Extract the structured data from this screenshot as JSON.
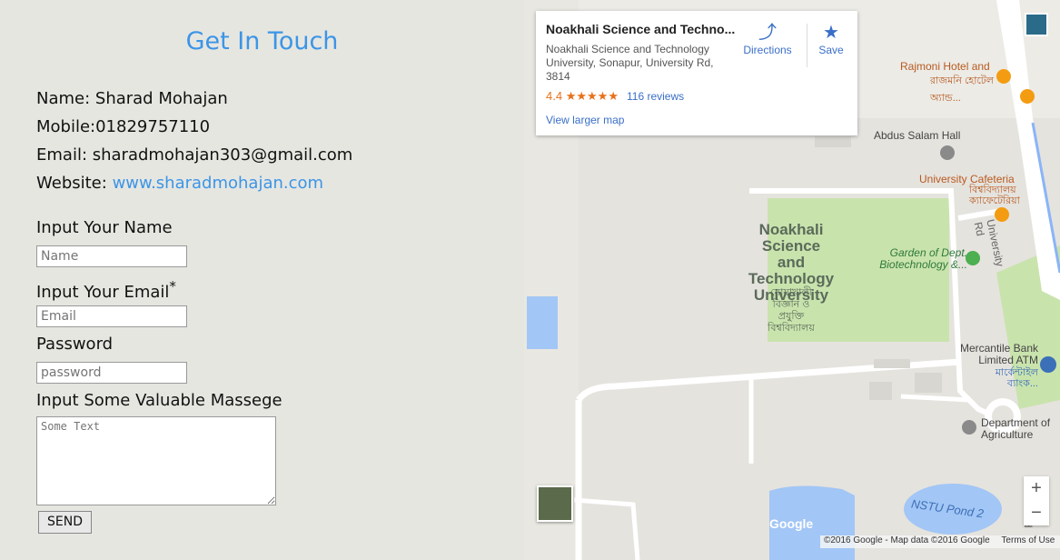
{
  "contact": {
    "title": "Get In Touch",
    "name_line": "Name: Sharad Mohajan",
    "mobile_line": "Mobile:01829757110",
    "email_line": "Email: sharadmohajan303@gmail.com",
    "website_label": "Website:",
    "website_link": "www.sharadmohajan.com"
  },
  "form": {
    "name_label": "Input Your Name",
    "name_placeholder": "Name",
    "email_label": "Input Your Email",
    "email_required": "*",
    "email_placeholder": "Email",
    "password_label": "Password",
    "password_placeholder": "password",
    "message_label": "Input Some Valuable Massege",
    "message_placeholder": "Some Text",
    "send_label": "SEND"
  },
  "map": {
    "place_name": "Noakhali Science and Techno...",
    "address": "Noakhali Science and Technology University, Sonapur, University Rd, 3814",
    "rating": "4.4",
    "stars": "★★★★★",
    "reviews": "116 reviews",
    "directions_label": "Directions",
    "save_label": "Save",
    "view_larger": "View larger map",
    "labels": {
      "university": "Noakhali Science and Technology University",
      "university_bn": "নোয়াখালী বিজ্ঞান ও প্রযুক্তি বিশ্ববিদ্যালয়",
      "rajmoni": "Rajmoni Hotel and",
      "rajmoni_bn": "রাজমনি হোটেল অ্যান্ড...",
      "abdus": "Abdus Salam Hall",
      "cafeteria": "University Cafeteria",
      "cafeteria_bn": "বিশ্ববিদ্যালয় ক্যাফেটেরিয়া",
      "garden": "Garden of Dept. Biotechnology &...",
      "mercantile": "Mercantile Bank Limited ATM",
      "mercantile_bn": "মার্কেন্টাইল ব্যাংক...",
      "agriculture": "Department of Agriculture",
      "pond": "NSTU Pond 2",
      "univ_rd": "University Rd",
      "rd": "Rd",
      "google": "Google"
    },
    "zoom_in": "+",
    "zoom_out": "−",
    "footer_data": "©2016 Google - Map data ©2016 Google",
    "footer_terms": "Terms of Use"
  }
}
